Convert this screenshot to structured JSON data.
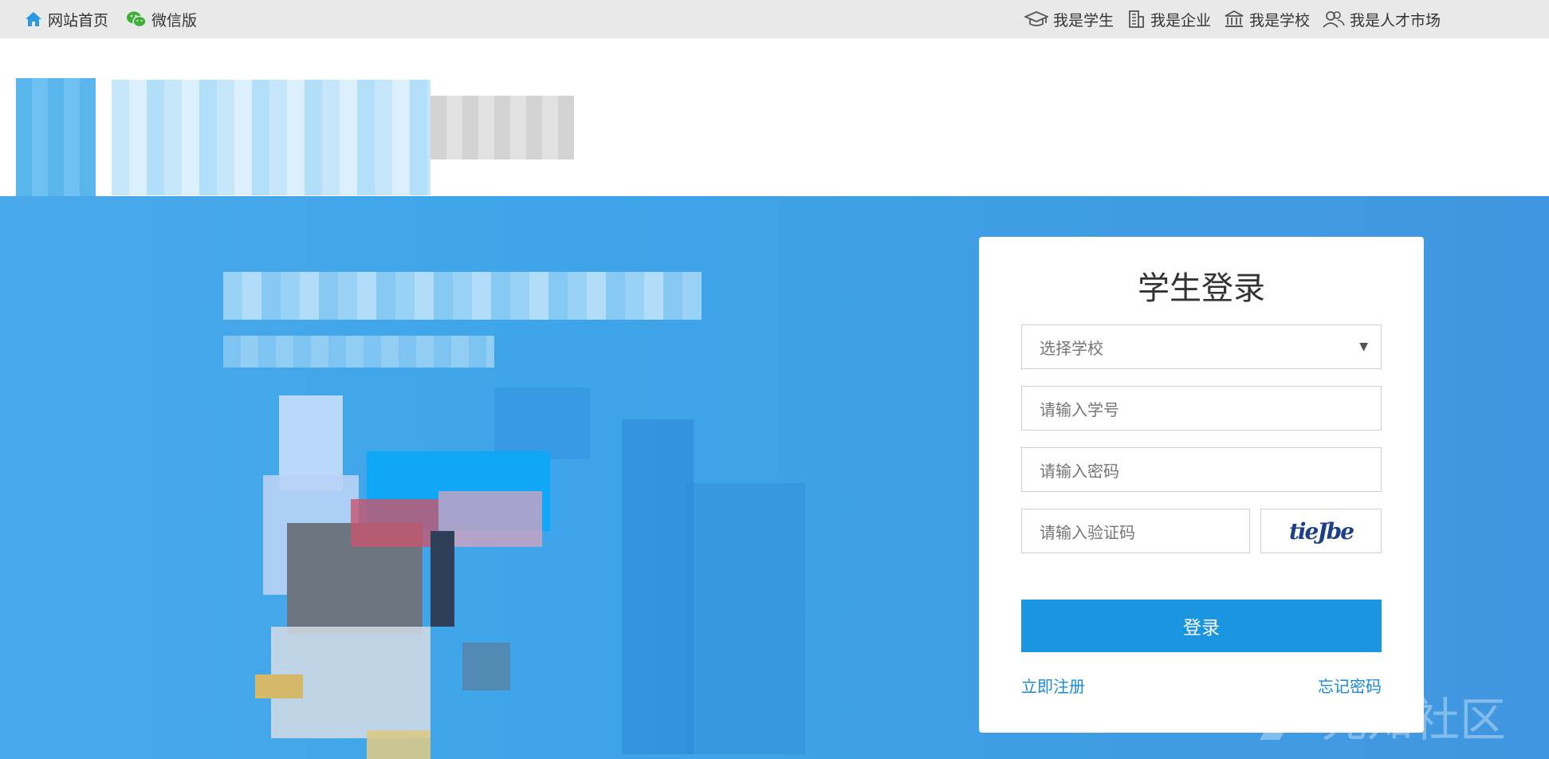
{
  "topbar": {
    "home_label": "网站首页",
    "wechat_label": "微信版",
    "student_label": "我是学生",
    "company_label": "我是企业",
    "school_label": "我是学校",
    "market_label": "我是人才市场"
  },
  "login": {
    "title": "学生登录",
    "school_select_value": "选择学校",
    "student_id_placeholder": "请输入学号",
    "password_placeholder": "请输入密码",
    "captcha_placeholder": "请输入验证码",
    "captcha_text": "tieJbe",
    "submit_label": "登录",
    "register_link": "立即注册",
    "forgot_link": "忘记密码"
  },
  "watermark": {
    "text": "先知社区"
  },
  "colors": {
    "primary": "#1a95e0",
    "link": "#1a8ad6",
    "topbar_bg": "#e9e9e9",
    "hero_bg": "#3ea5ea",
    "icon_blue": "#2b98e6",
    "wechat_green": "#3cb034"
  },
  "icons": {
    "home": "home-icon",
    "wechat": "wechat-icon",
    "student": "graduation-cap-icon",
    "company": "building-icon",
    "school": "school-icon",
    "market": "users-icon",
    "select_caret": "caret-down-icon"
  }
}
